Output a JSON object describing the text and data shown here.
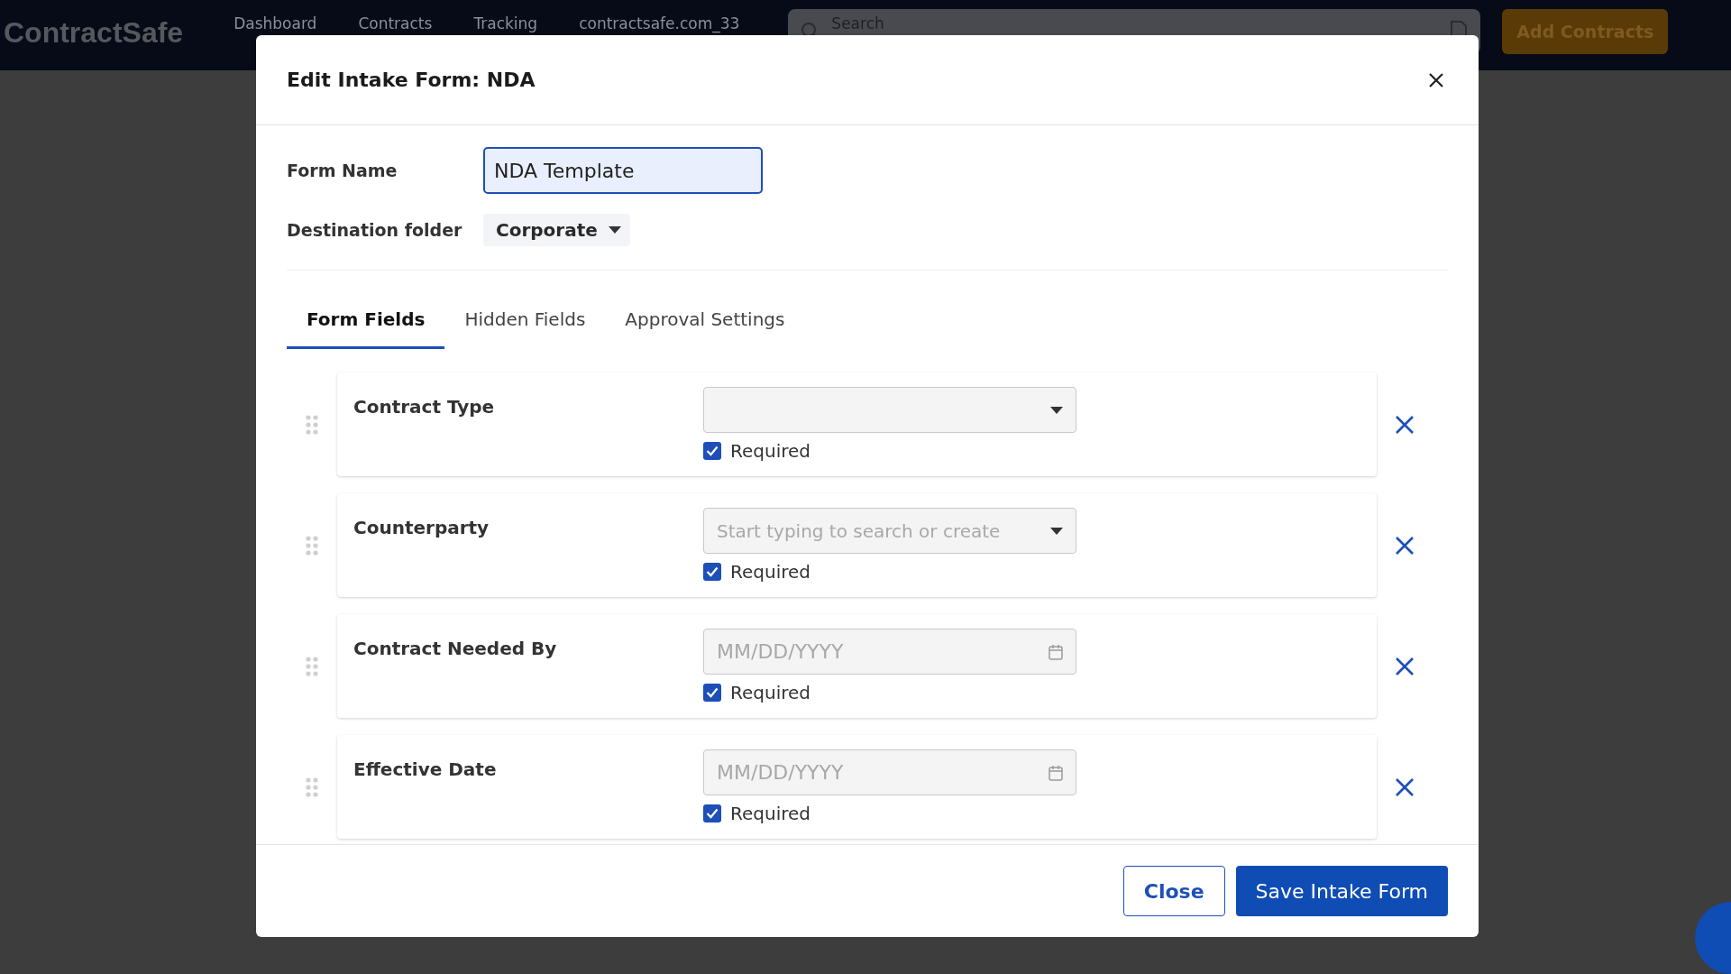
{
  "header": {
    "logo": "ContractSafe",
    "nav": [
      "Dashboard",
      "Contracts",
      "Tracking",
      "contractsafe.com_33"
    ],
    "search": {
      "placeholder": "Search"
    },
    "add_button": "Add Contracts"
  },
  "dialog": {
    "title": "Edit Intake Form: NDA",
    "form_name": {
      "label": "Form Name",
      "value": "NDA Template"
    },
    "destination": {
      "label": "Destination folder",
      "value": "Corporate"
    },
    "tabs": [
      {
        "label": "Form Fields",
        "selected": true
      },
      {
        "label": "Hidden Fields",
        "selected": false
      },
      {
        "label": "Approval Settings",
        "selected": false
      }
    ],
    "fields": [
      {
        "name": "Contract Type",
        "kind": "select",
        "required_label": "Required",
        "required": true
      },
      {
        "name": "Counterparty",
        "kind": "select",
        "placeholder": "Start typing to search or create",
        "required_label": "Required",
        "required": true
      },
      {
        "name": "Contract Needed By",
        "kind": "date",
        "placeholder": "MM/DD/YYYY",
        "required_label": "Required",
        "required": true
      },
      {
        "name": "Effective Date",
        "kind": "date",
        "placeholder": "MM/DD/YYYY",
        "required_label": "Required",
        "required": true
      }
    ],
    "buttons": {
      "close": "Close",
      "save": "Save Intake Form"
    }
  }
}
